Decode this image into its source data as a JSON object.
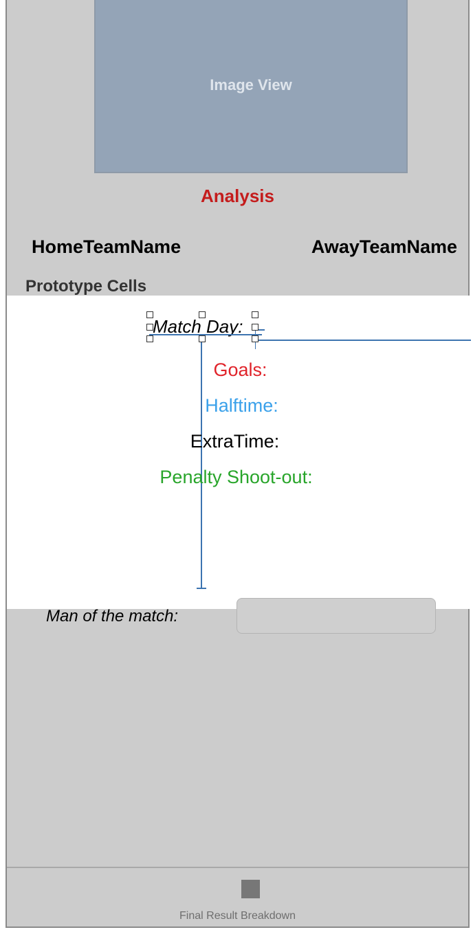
{
  "image_view": {
    "label": "Image View"
  },
  "header": {
    "analysis": "Analysis"
  },
  "teams": {
    "home": "HomeTeamName",
    "away": "AwayTeamName"
  },
  "section": {
    "prototype_cells": "Prototype Cells"
  },
  "cell": {
    "match_day": "Match Day:",
    "goals": "Goals:",
    "halftime": "Halftime:",
    "extratime": "ExtraTime:",
    "penalty": "Penalty Shoot-out:"
  },
  "man_of_the_match": {
    "label": "Man of the match:",
    "value": ""
  },
  "tabbar": {
    "item_label": "Final Result Breakdown",
    "item_icon": "square-icon"
  },
  "colors": {
    "analysis": "#c41c1c",
    "goals": "#e0232a",
    "halftime": "#3ba1ea",
    "penalty": "#28a52a",
    "guide": "#3d74b0"
  }
}
